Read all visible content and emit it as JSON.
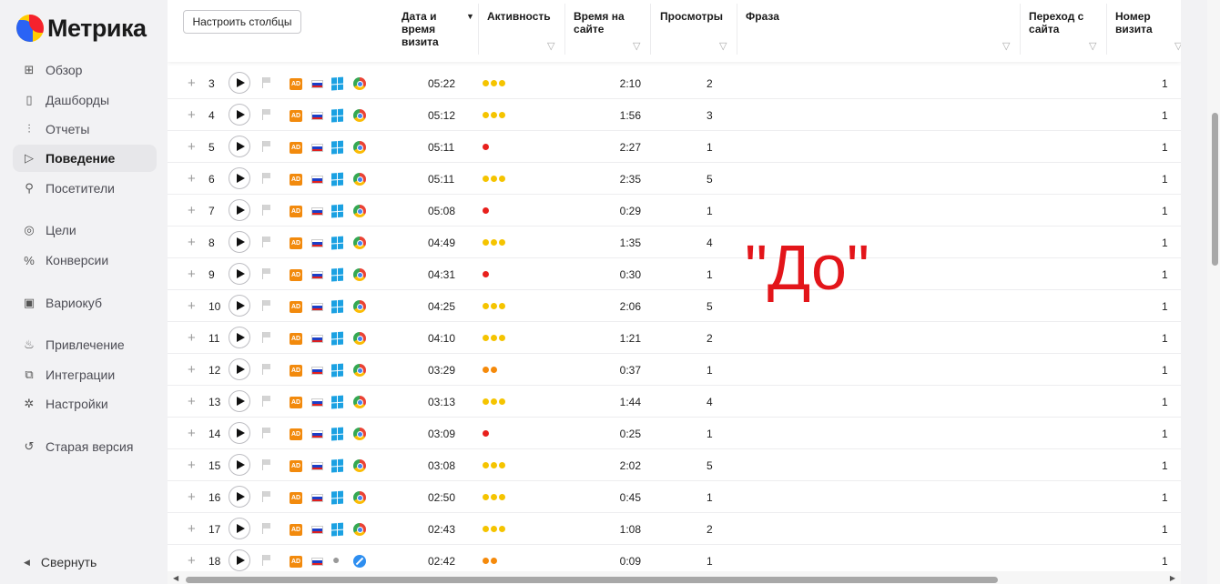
{
  "app": {
    "logo_text": "Метрика"
  },
  "sidebar": {
    "items": [
      {
        "label": "Обзор",
        "icon": "grid-icon",
        "glyph": "⊞"
      },
      {
        "label": "Дашборды",
        "icon": "dashboard-icon",
        "glyph": "▯"
      },
      {
        "label": "Отчеты",
        "icon": "reports-chart-icon",
        "glyph": "⫶"
      },
      {
        "label": "Поведение",
        "icon": "play-icon",
        "glyph": "▷",
        "active": true
      },
      {
        "label": "Посетители",
        "icon": "person-icon",
        "glyph": "⚲"
      },
      {
        "label": "Цели",
        "icon": "target-icon",
        "glyph": "◎"
      },
      {
        "label": "Конверсии",
        "icon": "percent-icon",
        "glyph": "%"
      },
      {
        "label": "Вариокуб",
        "icon": "cube-icon",
        "glyph": "▣"
      },
      {
        "label": "Привлечение",
        "icon": "flame-icon",
        "glyph": "♨"
      },
      {
        "label": "Интеграции",
        "icon": "puzzle-icon",
        "glyph": "⧉"
      },
      {
        "label": "Настройки",
        "icon": "gear-icon",
        "glyph": "✲"
      },
      {
        "label": "Старая версия",
        "icon": "undo-icon",
        "glyph": "↺"
      }
    ],
    "collapse_label": "Свернуть",
    "collapse_icon": "triangle-left-icon"
  },
  "toolbar": {
    "configure_columns": "Настроить столбцы"
  },
  "columns": {
    "date": "Дата и время визита",
    "activity": "Активность",
    "time_on_site": "Время на сайте",
    "views": "Просмотры",
    "phrase": "Фраза",
    "transition": "Переход с сайта",
    "visit_number": "Номер визита"
  },
  "colors": {
    "dot_yellow": "#f5c400",
    "dot_orange": "#f58a0b",
    "dot_red": "#e8201c",
    "annotation": "#e3151a",
    "brand_orange": "#f28a0d"
  },
  "rows": [
    {
      "n": "3",
      "time": "05:22",
      "activity": 3,
      "duration": "2:10",
      "views": "2",
      "visit": "1",
      "os": "windows",
      "browser": "chrome"
    },
    {
      "n": "4",
      "time": "05:12",
      "activity": 3,
      "duration": "1:56",
      "views": "3",
      "visit": "1",
      "os": "windows",
      "browser": "chrome"
    },
    {
      "n": "5",
      "time": "05:11",
      "activity": 1,
      "duration": "2:27",
      "views": "1",
      "visit": "1",
      "os": "windows",
      "browser": "chrome"
    },
    {
      "n": "6",
      "time": "05:11",
      "activity": 3,
      "duration": "2:35",
      "views": "5",
      "visit": "1",
      "os": "windows",
      "browser": "chrome"
    },
    {
      "n": "7",
      "time": "05:08",
      "activity": 1,
      "duration": "0:29",
      "views": "1",
      "visit": "1",
      "os": "windows",
      "browser": "chrome"
    },
    {
      "n": "8",
      "time": "04:49",
      "activity": 3,
      "duration": "1:35",
      "views": "4",
      "visit": "1",
      "os": "windows",
      "browser": "chrome"
    },
    {
      "n": "9",
      "time": "04:31",
      "activity": 1,
      "duration": "0:30",
      "views": "1",
      "visit": "1",
      "os": "windows",
      "browser": "chrome"
    },
    {
      "n": "10",
      "time": "04:25",
      "activity": 3,
      "duration": "2:06",
      "views": "5",
      "visit": "1",
      "os": "windows",
      "browser": "chrome"
    },
    {
      "n": "11",
      "time": "04:10",
      "activity": 3,
      "duration": "1:21",
      "views": "2",
      "visit": "1",
      "os": "windows",
      "browser": "chrome"
    },
    {
      "n": "12",
      "time": "03:29",
      "activity": 2,
      "duration": "0:37",
      "views": "1",
      "visit": "1",
      "os": "windows",
      "browser": "chrome"
    },
    {
      "n": "13",
      "time": "03:13",
      "activity": 3,
      "duration": "1:44",
      "views": "4",
      "visit": "1",
      "os": "windows",
      "browser": "chrome"
    },
    {
      "n": "14",
      "time": "03:09",
      "activity": 1,
      "duration": "0:25",
      "views": "1",
      "visit": "1",
      "os": "windows",
      "browser": "chrome"
    },
    {
      "n": "15",
      "time": "03:08",
      "activity": 3,
      "duration": "2:02",
      "views": "5",
      "visit": "1",
      "os": "windows",
      "browser": "chrome"
    },
    {
      "n": "16",
      "time": "02:50",
      "activity": 3,
      "duration": "0:45",
      "views": "1",
      "visit": "1",
      "os": "windows",
      "browser": "chrome"
    },
    {
      "n": "17",
      "time": "02:43",
      "activity": 3,
      "duration": "1:08",
      "views": "2",
      "visit": "1",
      "os": "windows",
      "browser": "chrome"
    },
    {
      "n": "18",
      "time": "02:42",
      "activity": 2,
      "duration": "0:09",
      "views": "1",
      "visit": "1",
      "os": "apple",
      "browser": "safari"
    }
  ],
  "ad_badge": "AD",
  "annotation": "\"До\""
}
